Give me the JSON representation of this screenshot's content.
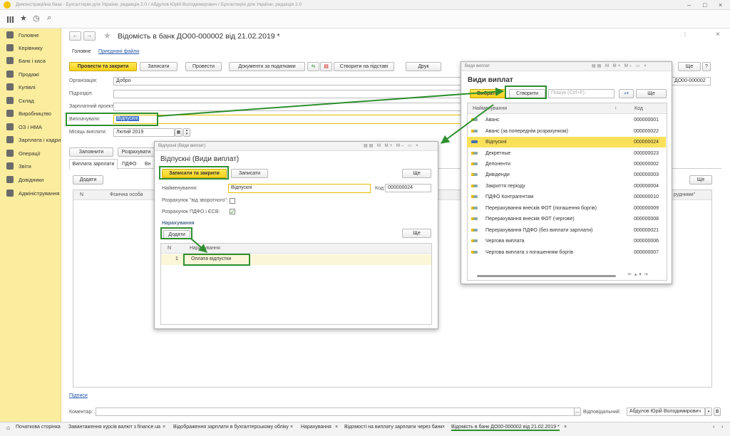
{
  "window_title": "Демонстраційна база - Бухгалтерія для України, редакція 2.0 / Абдулов Юрій Володимирович / Бухгалтерія для України, редакція 2.0",
  "sidebar": {
    "items": [
      {
        "label": "Головне",
        "icon": "menu-icon"
      },
      {
        "label": "Керівнику",
        "icon": "chart-icon"
      },
      {
        "label": "Банк і каса",
        "icon": "bank-icon"
      },
      {
        "label": "Продажі",
        "icon": "cart-icon"
      },
      {
        "label": "Купівлі",
        "icon": "basket-icon"
      },
      {
        "label": "Склад",
        "icon": "warehouse-icon"
      },
      {
        "label": "Виробництво",
        "icon": "factory-icon"
      },
      {
        "label": "ОЗ і НМА",
        "icon": "assets-icon"
      },
      {
        "label": "Зарплата і кадри",
        "icon": "people-icon"
      },
      {
        "label": "Операції",
        "icon": "operations-icon"
      },
      {
        "label": "Звіти",
        "icon": "reports-icon"
      },
      {
        "label": "Довідники",
        "icon": "book-icon"
      },
      {
        "label": "Адміністрування",
        "icon": "gear-icon"
      }
    ]
  },
  "doc": {
    "title": "Відомість в банк ДО00-000002 від 21.02.2019 *",
    "nav_main": "Головне",
    "nav_files": "Приєднані файли",
    "btn_post_close": "Провести та закрити",
    "btn_save": "Записати",
    "btn_post": "Провести",
    "btn_tax_docs": "Документи за податками",
    "btn_create_based": "Створити на підставі",
    "btn_print": "Друк",
    "btn_more": "Ще",
    "btn_help": "?",
    "org_label": "Організація:",
    "org_value": "Добро",
    "dept_label": "Підрозділ:",
    "salary_label": "Зарплатний проект:",
    "pay_label": "Виплачувати:",
    "pay_value": "Відпускні",
    "month_label": "Місяць виплати:",
    "month_value": "Лютий 2019",
    "number_value": "ДО00-000002",
    "btn_fill": "Заповнити",
    "btn_calc": "Розрахувати",
    "tabs": [
      "Виплата зарплати",
      "ПДФО",
      "Вн"
    ],
    "btn_add": "Додати",
    "col_n": "N",
    "col_person": "Фізична особа",
    "col_right": "рудними\"",
    "signatures_link": "Підписи",
    "comment_label": "Коментар:",
    "responsible_label": "Відповідальний:",
    "responsible_value": "Абдулов Юрій Володимирович"
  },
  "types_window": {
    "title_small": "Види виплат",
    "heading": "Види виплат",
    "btn_select": "Вибрати",
    "btn_create": "Створити",
    "search_placeholder": "Пошук (Ctrl+F)",
    "btn_more": "Ще",
    "col_name": "Найменування",
    "col_code": "Код",
    "rows": [
      {
        "name": "Аванс",
        "code": "000000001"
      },
      {
        "name": "Аванс (за попереднім розрахунком)",
        "code": "000000022"
      },
      {
        "name": "Відпускні",
        "code": "000000024"
      },
      {
        "name": "Декретные",
        "code": "000000023"
      },
      {
        "name": "Депоненти",
        "code": "000000002"
      },
      {
        "name": "Дивіденди",
        "code": "000000003"
      },
      {
        "name": "Закриття періоду",
        "code": "000000004"
      },
      {
        "name": "ПДФО Контрагентам",
        "code": "000000010"
      },
      {
        "name": "Перерахування внесків ФОТ (погашення боргів)",
        "code": "000000009"
      },
      {
        "name": "Перерахування внесків ФОТ (чергове)",
        "code": "000000008"
      },
      {
        "name": "Перерахування ПДФО (без виплати зарплати)",
        "code": "000000021"
      },
      {
        "name": "Чергова виплата",
        "code": "000000006"
      },
      {
        "name": "Чергова виплата з погашенням боргів",
        "code": "000000007"
      }
    ]
  },
  "item_window": {
    "title_small": "Відпускні (Види виплат)",
    "heading": "Відпускні (Види виплат)",
    "btn_save_close": "Записати та закрити",
    "btn_save": "Записати",
    "btn_more": "Ще",
    "name_label": "Найменування:",
    "name_value": "Відпускні",
    "code_label": "Код:",
    "code_value": "000000024",
    "reverse_label": "Розрахунок \"від зворотного\":",
    "pdfo_label": "Розрахунок ПДФО і ЄСВ:",
    "section": "Нарахування",
    "btn_add": "Додати",
    "btn_more2": "Ще",
    "col_n": "N",
    "col_name": "Нарахування",
    "row_n": "1",
    "row_name": "Оплата відпустки"
  },
  "bottom_tabs": [
    "Початкова сторінка",
    "Завантаження курсів валют з finance.ua",
    "Відображення зарплати в бухгалтерському обліку",
    "Нарахування",
    "Відомості на виплату зарплати через банк",
    "Відомість в банк ДО00-000002 від 21.02.2019 *"
  ]
}
